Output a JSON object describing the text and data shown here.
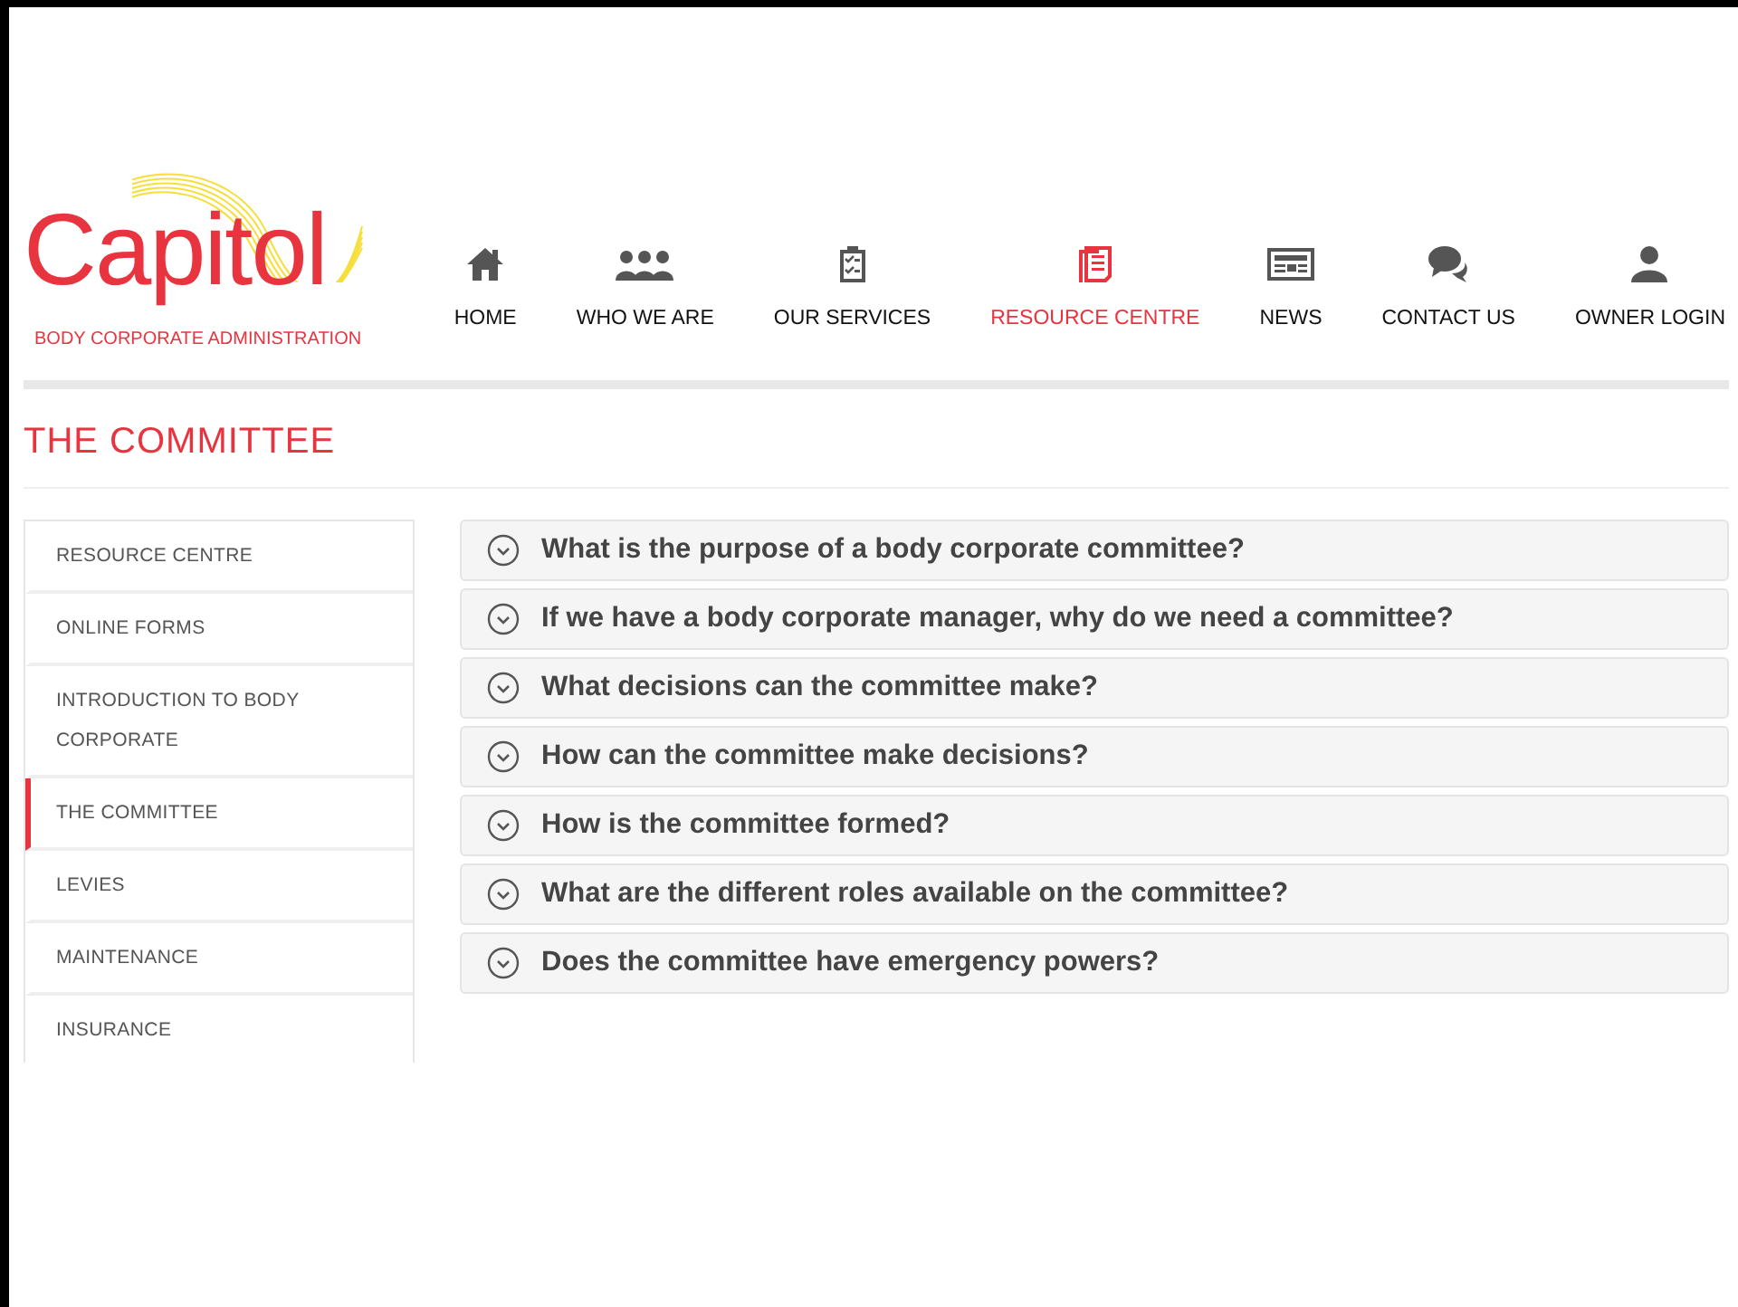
{
  "logo": {
    "name": "Capitol",
    "tagline": "BODY CORPORATE ADMINISTRATION"
  },
  "nav": [
    {
      "label": "HOME",
      "selected": false
    },
    {
      "label": "WHO WE ARE",
      "selected": false
    },
    {
      "label": "OUR SERVICES",
      "selected": false
    },
    {
      "label": "RESOURCE CENTRE",
      "selected": true
    },
    {
      "label": "NEWS",
      "selected": false
    },
    {
      "label": "CONTACT US",
      "selected": false
    },
    {
      "label": "OWNER LOGIN",
      "selected": false
    }
  ],
  "page_title": "THE COMMITTEE",
  "sidebar": {
    "items": [
      {
        "label": "RESOURCE CENTRE",
        "selected": false
      },
      {
        "label": "ONLINE FORMS",
        "selected": false
      },
      {
        "label": "INTRODUCTION TO BODY CORPORATE",
        "selected": false
      },
      {
        "label": "THE COMMITTEE",
        "selected": true
      },
      {
        "label": "LEVIES",
        "selected": false
      },
      {
        "label": "MAINTENANCE",
        "selected": false
      },
      {
        "label": "INSURANCE",
        "selected": false
      }
    ]
  },
  "faq": [
    {
      "question": "What is the purpose of a body corporate committee?",
      "expanded": false
    },
    {
      "question": "If we have a body corporate manager, why do we need a committee?",
      "expanded": false
    },
    {
      "question": "What decisions can the committee make?",
      "expanded": false
    },
    {
      "question": "How can the committee make decisions?",
      "expanded": false
    },
    {
      "question": "How is the committee formed?",
      "expanded": false
    },
    {
      "question": "What are the different roles available on the committee?",
      "expanded": false
    },
    {
      "question": "Does the committee have emergency powers?",
      "expanded": false
    }
  ]
}
